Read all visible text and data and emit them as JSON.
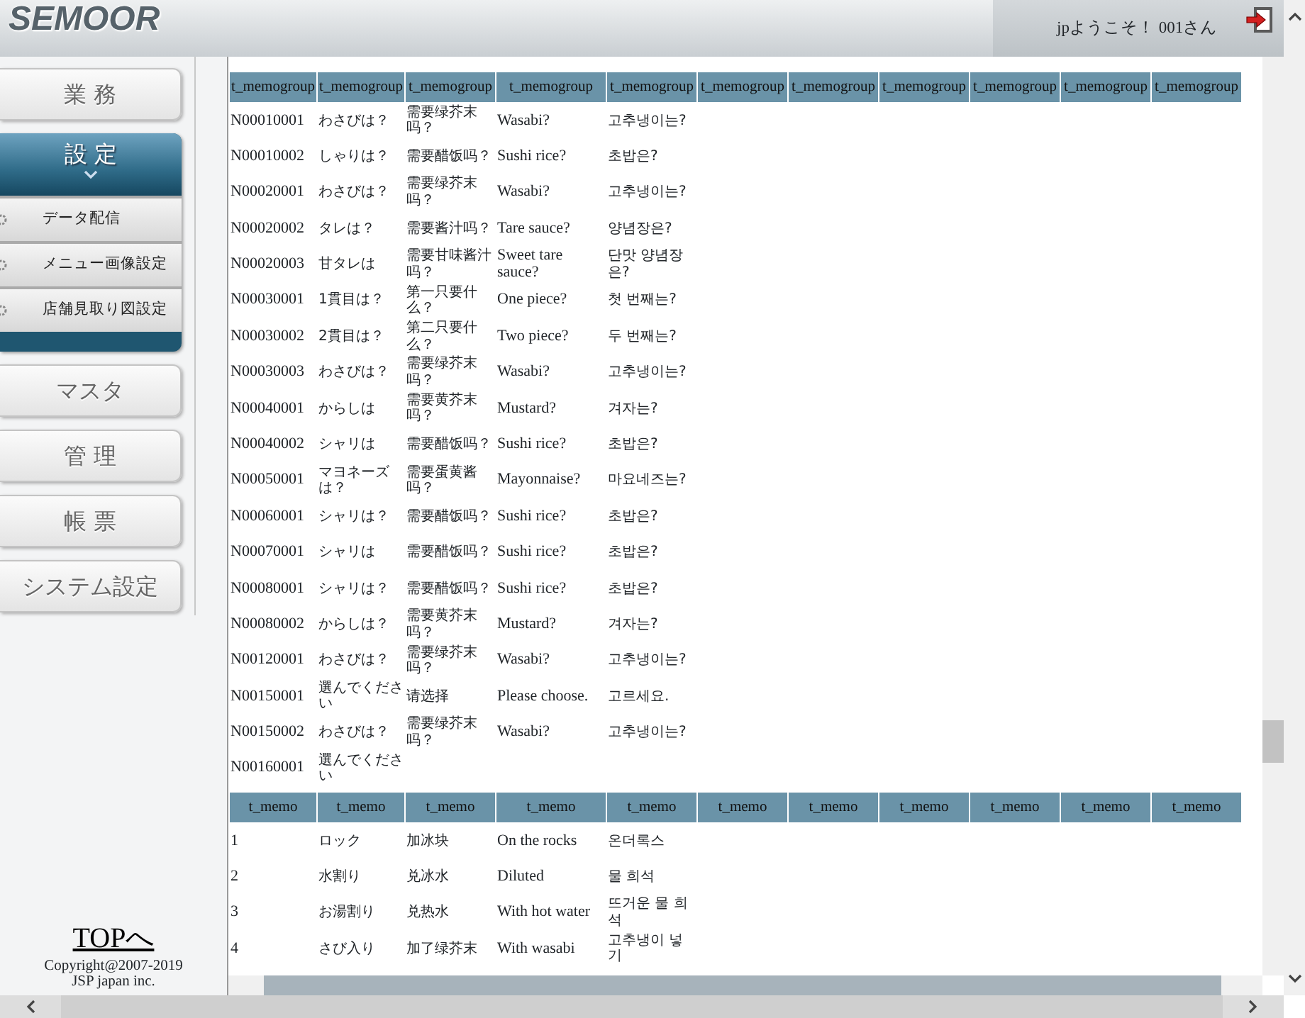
{
  "header": {
    "logo": "SEMOOR",
    "welcome": "jpようこそ！ 001さん"
  },
  "sidebar": {
    "items": [
      {
        "label": "業 務",
        "selected": false
      },
      {
        "label": "設 定",
        "selected": true,
        "submenu": [
          "データ配信",
          "メニュー画像設定",
          "店舗見取り図設定"
        ]
      },
      {
        "label": "マスタ",
        "selected": false
      },
      {
        "label": "管 理",
        "selected": false
      },
      {
        "label": "帳 票",
        "selected": false
      },
      {
        "label": "システム設定",
        "selected": false
      }
    ],
    "top_link": "TOPへ",
    "copyright": [
      "Copyright@2007-2019",
      "JSP japan inc."
    ]
  },
  "tables": [
    {
      "columns": [
        "t_memogroup",
        "t_memogroup",
        "t_memogroup",
        "t_memogroup",
        "t_memogroup",
        "t_memogroup",
        "t_memogroup",
        "t_memogroup",
        "t_memogroup",
        "t_memogroup",
        "t_memogroup"
      ],
      "rows": [
        [
          "N00010001",
          "わさびは？",
          "需要绿芥末吗？",
          "Wasabi?",
          "고추냉이는?"
        ],
        [
          "N00010002",
          "しゃりは？",
          "需要醋饭吗？",
          "Sushi rice?",
          "초밥은?"
        ],
        [
          "N00020001",
          "わさびは？",
          "需要绿芥末吗？",
          "Wasabi?",
          "고추냉이는?"
        ],
        [
          "N00020002",
          "タレは？",
          "需要酱汁吗？",
          "Tare sauce?",
          "양념장은?"
        ],
        [
          "N00020003",
          "甘タレは",
          "需要甘味酱汁吗？",
          "Sweet tare sauce?",
          "단맛 양념장은?"
        ],
        [
          "N00030001",
          "1貫目は？",
          "第一只要什么？",
          "One piece?",
          "첫 번째는?"
        ],
        [
          "N00030002",
          "2貫目は？",
          "第二只要什么？",
          "Two piece?",
          "두 번째는?"
        ],
        [
          "N00030003",
          "わさびは？",
          "需要绿芥末吗？",
          "Wasabi?",
          "고추냉이는?"
        ],
        [
          "N00040001",
          "からしは",
          "需要黄芥末吗？",
          "Mustard?",
          "겨자는?"
        ],
        [
          "N00040002",
          "シャリは",
          "需要醋饭吗？",
          "Sushi rice?",
          "초밥은?"
        ],
        [
          "N00050001",
          "マヨネーズは？",
          "需要蛋黄酱吗？",
          "Mayonnaise?",
          "마요네즈는?"
        ],
        [
          "N00060001",
          "シャリは？",
          "需要醋饭吗？",
          "Sushi rice?",
          "초밥은?"
        ],
        [
          "N00070001",
          "シャリは",
          "需要醋饭吗？",
          "Sushi rice?",
          "초밥은?"
        ],
        [
          "N00080001",
          "シャリは？",
          "需要醋饭吗？",
          "Sushi rice?",
          "초밥은?"
        ],
        [
          "N00080002",
          "からしは？",
          "需要黄芥末吗？",
          "Mustard?",
          "겨자는?"
        ],
        [
          "N00120001",
          "わさびは？",
          "需要绿芥末吗？",
          "Wasabi?",
          "고추냉이는?"
        ],
        [
          "N00150001",
          "選んでください",
          "请选择",
          "Please choose.",
          "고르세요."
        ],
        [
          "N00150002",
          "わさびは？",
          "需要绿芥末吗？",
          "Wasabi?",
          "고추냉이는?"
        ],
        [
          "N00160001",
          "選んでください"
        ]
      ]
    },
    {
      "columns": [
        "t_memo",
        "t_memo",
        "t_memo",
        "t_memo",
        "t_memo",
        "t_memo",
        "t_memo",
        "t_memo",
        "t_memo",
        "t_memo",
        "t_memo"
      ],
      "rows": [
        [
          "1",
          "ロック",
          "加冰块",
          "On the rocks",
          "온더록스"
        ],
        [
          "2",
          "水割り",
          "兑冰水",
          "Diluted",
          "물 희석"
        ],
        [
          "3",
          "お湯割り",
          "兑热水",
          "With hot water",
          "뜨거운 물 희석"
        ],
        [
          "4",
          "さび入り",
          "加了绿芥末",
          "With wasabi",
          "고추냉이 넣기"
        ]
      ]
    }
  ]
}
